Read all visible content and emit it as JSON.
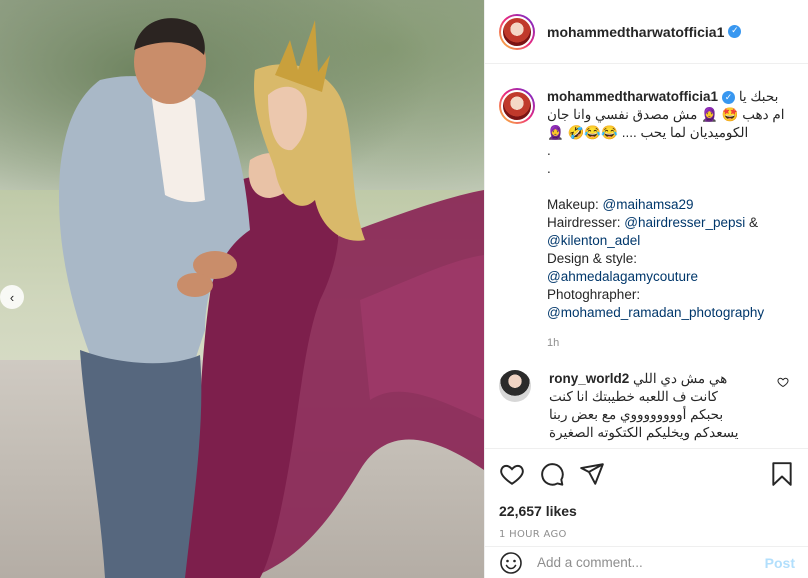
{
  "post": {
    "username": "mohammedtharwatofficia1",
    "verified": true,
    "caption": {
      "lines_rtl": [
        "بحبك يا",
        "ام دهب 🤩 🧕 مش مصدق نفسي وانا جان",
        "الكوميديان لما يحب .... 😂😂🤣 🧕"
      ],
      "dots": [
        ".",
        "."
      ],
      "credits": [
        {
          "label": "Makeup: ",
          "handle": "@maihamsa29"
        },
        {
          "label": "Hairdresser: ",
          "handle": "@hairdresser_pepsi",
          "suffix": " &"
        },
        {
          "label": "",
          "handle": "@kilenton_adel"
        },
        {
          "label": "Design & style:",
          "handle": ""
        },
        {
          "label": "",
          "handle": "@ahmedalagamycouture"
        },
        {
          "label": "Photoghrapher:",
          "handle": ""
        },
        {
          "label": "",
          "handle": "@mohamed_ramadan_photography"
        }
      ],
      "time": "1h"
    },
    "comment": {
      "username": "rony_world2",
      "lines_rtl": [
        "هي مش دي اللي",
        "كانت ف اللعبه خطيبتك انا كنت",
        "بحبكم أووووووووي مع بعض ربنا",
        "يسعدكم ويخليكم الكتكوته الصغيرة"
      ]
    },
    "likes": "22,657 likes",
    "ago": "1 HOUR AGO",
    "add_comment_placeholder": "Add a comment...",
    "post_label": "Post",
    "nav_arrow": "‹"
  },
  "icons": {
    "heart": "heart-icon",
    "comment": "comment-icon",
    "share": "share-icon",
    "bookmark": "bookmark-icon",
    "emoji": "emoji-icon"
  },
  "colors": {
    "link": "#00376b",
    "verified": "#3897f0",
    "muted": "#8e8e8e",
    "post_disabled": "#b2dffc"
  }
}
